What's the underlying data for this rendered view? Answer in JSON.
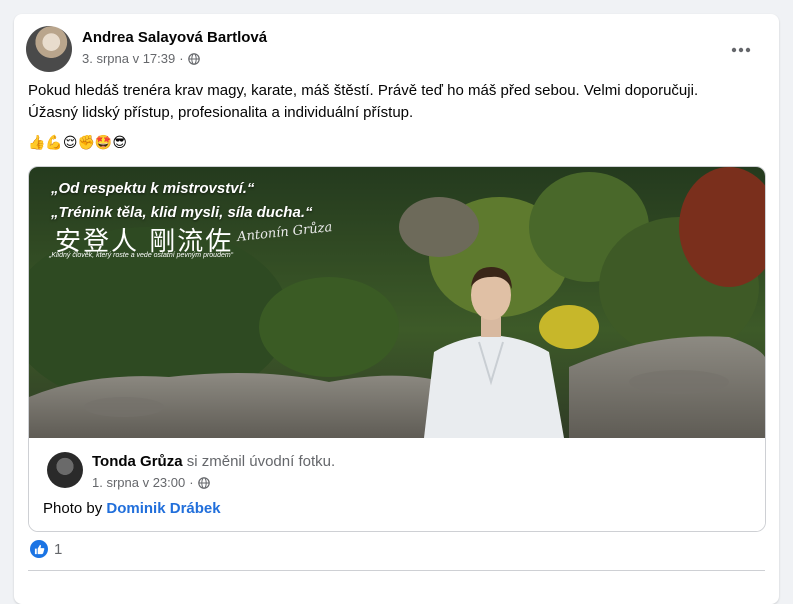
{
  "post": {
    "author": "Andrea Salayová Bartlová",
    "timestamp": "3. srpna v 17:39",
    "separator": "·",
    "privacy_icon": "globe-icon",
    "more_icon": "more-horizontal-icon",
    "text_line1": "Pokud hledáš trenéra krav magy, karate, máš štěstí. Právě teď ho máš před sebou. Velmi doporučuji.",
    "text_line2": "Úžasný lidský přístup, profesionalita a individuální přístup.",
    "emojis": "👍💪😌✊🤩😎"
  },
  "shared": {
    "cover_quote1": "„Od respektu k mistrovství.“",
    "cover_quote2": "„Trénink těla, klid mysli, síla ducha.“",
    "cover_kanji": "安登人 剛流佐",
    "cover_small": "„Klidný člověk, který roste a vede ostatní pevným proudem“",
    "cover_signature": "Antonín Grůza",
    "name": "Tonda Grůza",
    "action": " si změnil úvodní fotku.",
    "timestamp": "1. srpna v 23:00",
    "separator": "·",
    "credit_prefix": "Photo by ",
    "credit_name": "Dominik Drábek"
  },
  "reactions": {
    "icon": "like-icon",
    "count": "1"
  },
  "colors": {
    "accent": "#1b74e4",
    "link": "#216fdb",
    "secondary_text": "#65676b",
    "background": "#f0f2f5"
  }
}
